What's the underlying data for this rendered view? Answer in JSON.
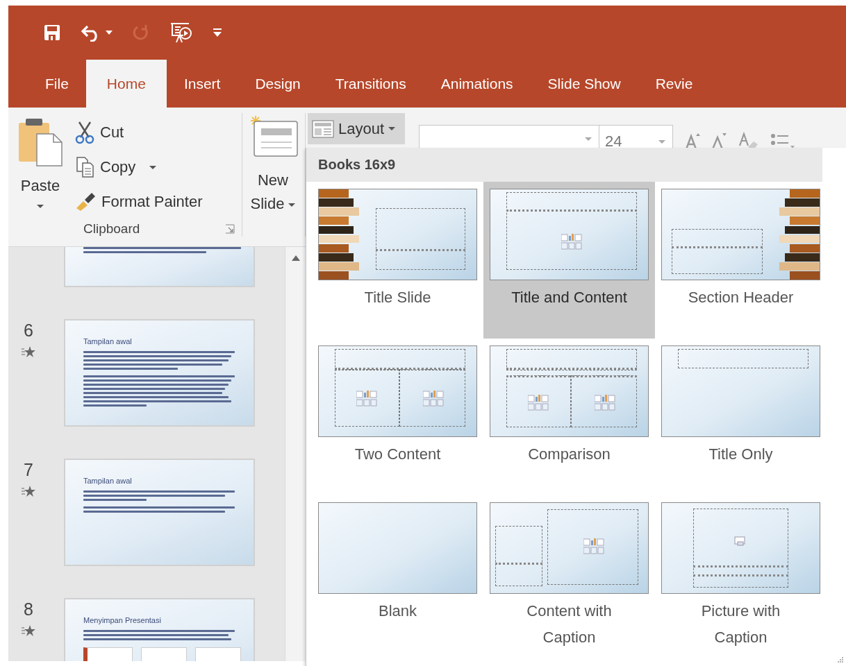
{
  "quick_access": [
    {
      "kind": "save",
      "disabled": false
    },
    {
      "kind": "undo",
      "disabled": false
    },
    {
      "kind": "redo",
      "disabled": true
    },
    {
      "kind": "present",
      "disabled": false
    },
    {
      "kind": "customize",
      "disabled": false
    }
  ],
  "tabs": [
    {
      "label": "File",
      "selected": false
    },
    {
      "label": "Home",
      "selected": true
    },
    {
      "label": "Insert",
      "selected": false
    },
    {
      "label": "Design",
      "selected": false
    },
    {
      "label": "Transitions",
      "selected": false
    },
    {
      "label": "Animations",
      "selected": false
    },
    {
      "label": "Slide Show",
      "selected": false
    },
    {
      "label": "Revie",
      "selected": false
    }
  ],
  "clipboard": {
    "paste": "Paste",
    "cut": "Cut",
    "copy": "Copy",
    "format_painter": "Format Painter",
    "group_label": "Clipboard"
  },
  "new_slide": {
    "label": "New Slide"
  },
  "layout_button": {
    "label": "Layout"
  },
  "font": {
    "size": "24"
  },
  "slides": [
    {
      "kind": "tail"
    },
    {
      "number": "6",
      "title": "Tampilan awal",
      "kind": "long",
      "animated": true
    },
    {
      "number": "7",
      "title": "Tampilan awal",
      "kind": "short",
      "animated": true
    },
    {
      "number": "8",
      "title": "Menyimpan Presentasi",
      "kind": "screenshot",
      "animated": true
    }
  ],
  "layout_gallery": {
    "header": "Books 16x9",
    "items": [
      {
        "label": "Title Slide",
        "kind": "title",
        "selected": false
      },
      {
        "label": "Title and Content",
        "kind": "content",
        "selected": true
      },
      {
        "label": "Section Header",
        "kind": "section",
        "selected": false
      },
      {
        "label": "Two Content",
        "kind": "two",
        "selected": false
      },
      {
        "label": "Comparison",
        "kind": "comparison",
        "selected": false
      },
      {
        "label": "Title Only",
        "kind": "titleonly",
        "selected": false
      },
      {
        "label": "Blank",
        "kind": "blank",
        "selected": false
      },
      {
        "label": "Content with Caption",
        "kind": "captioncontent",
        "selected": false
      },
      {
        "label": "Picture with Caption",
        "kind": "captionpicture",
        "selected": false
      }
    ]
  }
}
